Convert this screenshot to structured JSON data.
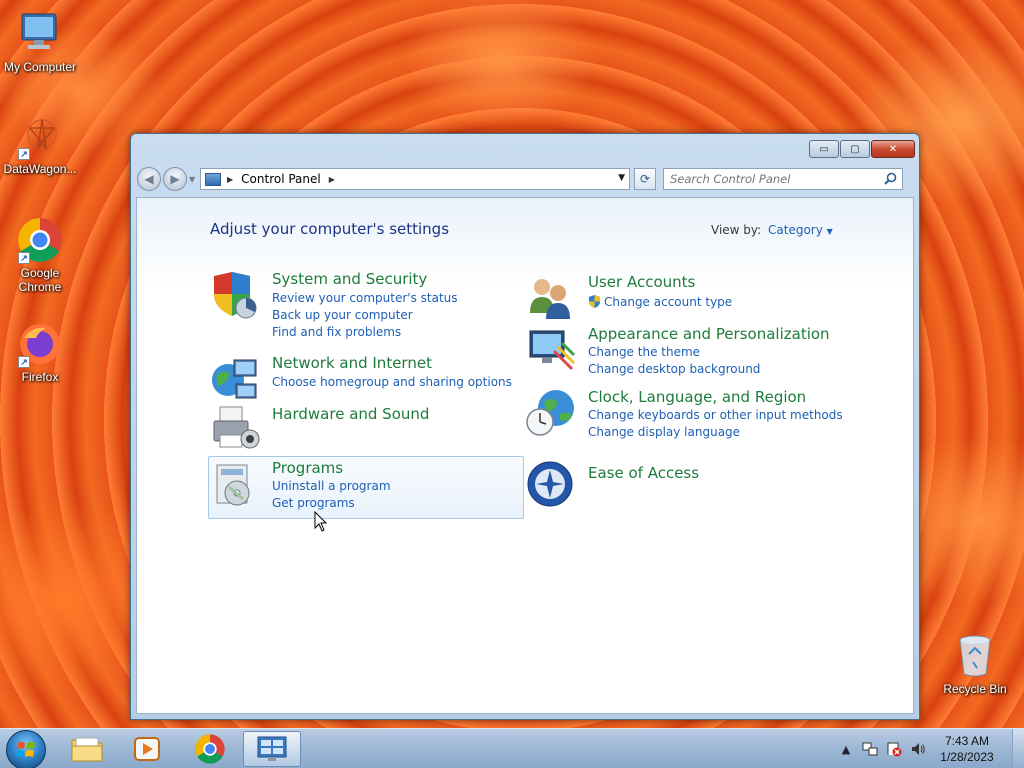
{
  "desktop": {
    "icons": [
      {
        "label": "My Computer"
      },
      {
        "label": "DataWagon..."
      },
      {
        "label": "Google Chrome"
      },
      {
        "label": "Firefox"
      },
      {
        "label": "Recycle Bin"
      }
    ]
  },
  "window": {
    "controls": {
      "minimize": "▭",
      "maximize": "▢",
      "close": "✕"
    },
    "address": {
      "path_items": [
        "Control Panel"
      ]
    },
    "search": {
      "placeholder": "Search Control Panel"
    }
  },
  "content": {
    "heading": "Adjust your computer's settings",
    "view_by_label": "View by:",
    "view_by_value": "Category",
    "categories": [
      {
        "title": "System and Security",
        "icon": "shield-icon",
        "links": [
          "Review your computer's status",
          "Back up your computer",
          "Find and fix problems"
        ]
      },
      {
        "title": "Network and Internet",
        "icon": "globe-network-icon",
        "links": [
          "Choose homegroup and sharing options"
        ]
      },
      {
        "title": "Hardware and Sound",
        "icon": "printer-icon",
        "links": []
      },
      {
        "title": "Programs",
        "icon": "programs-icon",
        "links": [
          "Uninstall a program",
          "Get programs"
        ]
      },
      {
        "title": "User Accounts",
        "icon": "users-icon",
        "links": [
          "Change account type"
        ]
      },
      {
        "title": "Appearance and Personalization",
        "icon": "monitor-palette-icon",
        "links": [
          "Change the theme",
          "Change desktop background"
        ]
      },
      {
        "title": "Clock, Language, and Region",
        "icon": "clock-globe-icon",
        "links": [
          "Change keyboards or other input methods",
          "Change display language"
        ]
      },
      {
        "title": "Ease of Access",
        "icon": "ease-of-access-icon",
        "links": []
      }
    ]
  },
  "taskbar": {
    "items": [
      "start-orb",
      "explorer",
      "media-player",
      "chrome",
      "control-panel"
    ],
    "clock": {
      "time": "7:43 AM",
      "date": "1/28/2023"
    }
  },
  "colors": {
    "category_title": "#1e7b3c",
    "link": "#1e5fb4",
    "heading": "#1e3287"
  }
}
